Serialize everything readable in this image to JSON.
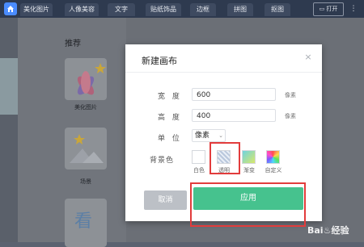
{
  "nav": {
    "tabs": [
      "美化图片",
      "人像美容",
      "文字",
      "贴纸饰品",
      "边框",
      "拼图",
      "抠图"
    ],
    "open_label": "打开",
    "user_label": "⋮"
  },
  "panel": {
    "title": "推荐",
    "cards": [
      {
        "label": "美化图片",
        "icon": "flower-icon"
      },
      {
        "label": "场景",
        "icon": "landscape-icon"
      },
      {
        "label": "",
        "glyph": "看"
      }
    ]
  },
  "dialog": {
    "title": "新建画布",
    "close": "×",
    "width_label": "宽 度",
    "width_value": "600",
    "height_label": "高 度",
    "height_value": "400",
    "unit_label": "单 位",
    "unit_value": "像素",
    "unit_suffix": "像素",
    "bg_label": "背景色",
    "swatches": [
      {
        "label": "白色",
        "color": "#ffffff"
      },
      {
        "label": "透明",
        "color": "transparent"
      },
      {
        "label": "渐变",
        "color": "#7dd8d0"
      },
      {
        "label": "自定义",
        "color": "rainbow"
      }
    ],
    "cancel_label": "取消",
    "apply_label": "应用"
  },
  "watermark": "Bai♨经验",
  "colors": {
    "accent": "#46c28e",
    "highlight": "#e23c3c",
    "nav": "#2e3a4f"
  }
}
